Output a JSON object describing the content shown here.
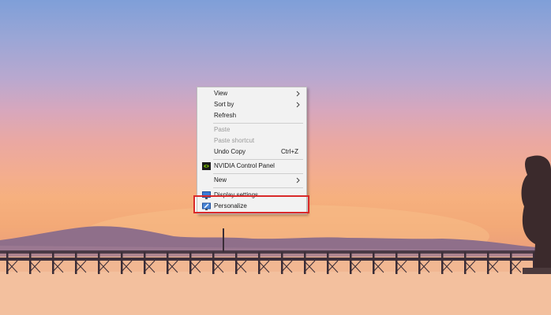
{
  "desktop": {
    "context_menu": {
      "items": [
        {
          "label": "View",
          "has_submenu": true
        },
        {
          "label": "Sort by",
          "has_submenu": true
        },
        {
          "label": "Refresh"
        },
        {
          "label": "Paste",
          "disabled": true
        },
        {
          "label": "Paste shortcut",
          "disabled": true
        },
        {
          "label": "Undo Copy",
          "shortcut": "Ctrl+Z"
        },
        {
          "label": "NVIDIA Control Panel",
          "icon": "nvidia-icon"
        },
        {
          "label": "New",
          "has_submenu": true
        },
        {
          "label": "Display settings",
          "icon": "display-settings-icon"
        },
        {
          "label": "Personalize",
          "icon": "personalize-icon",
          "highlighted": true
        }
      ]
    },
    "highlight_color": "#d92a2a"
  }
}
